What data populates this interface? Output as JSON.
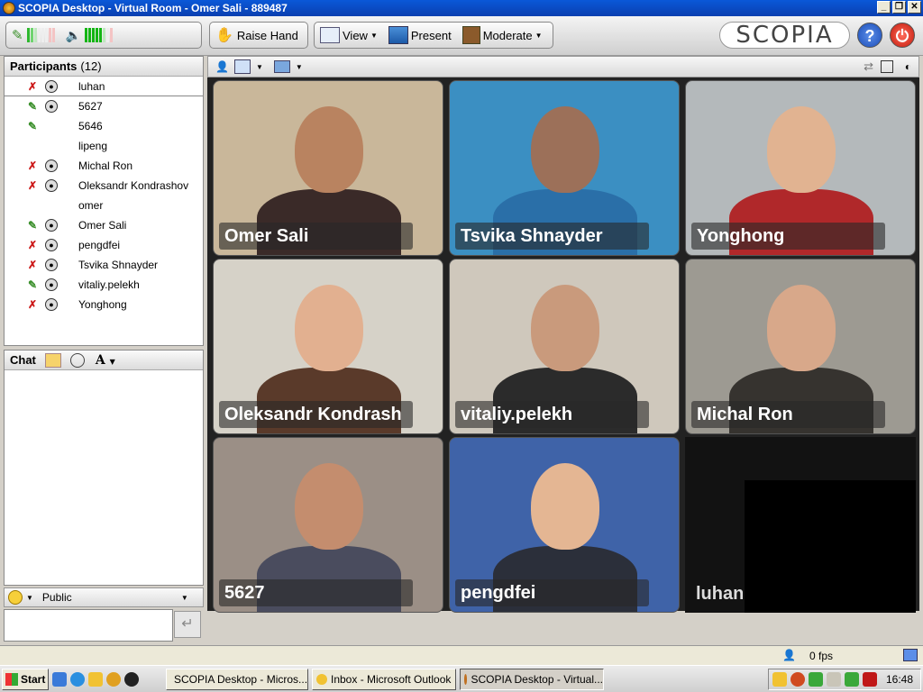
{
  "window": {
    "title": "SCOPIA Desktop - Virtual Room - Omer Sali - 889487"
  },
  "toolbar": {
    "raise_hand_label": "Raise Hand",
    "view_label": "View",
    "present_label": "Present",
    "moderate_label": "Moderate",
    "logo_text": "SCOPIA",
    "help_label": "?"
  },
  "participants": {
    "title": "Participants",
    "count": "(12)",
    "items": [
      {
        "name": "luhan",
        "mic": "muted",
        "camera": true
      },
      {
        "name": "5627",
        "mic": "on",
        "camera": true
      },
      {
        "name": "5646",
        "mic": "on",
        "camera": false
      },
      {
        "name": "lipeng",
        "mic": "none",
        "camera": false
      },
      {
        "name": "Michal Ron",
        "mic": "muted",
        "camera": true
      },
      {
        "name": "Oleksandr Kondrashov",
        "mic": "muted",
        "camera": true
      },
      {
        "name": "omer",
        "mic": "none",
        "camera": false
      },
      {
        "name": "Omer Sali",
        "mic": "on",
        "camera": true
      },
      {
        "name": "pengdfei",
        "mic": "muted",
        "camera": true
      },
      {
        "name": "Tsvika Shnayder",
        "mic": "muted",
        "camera": true
      },
      {
        "name": "vitaliy.pelekh",
        "mic": "on",
        "camera": true
      },
      {
        "name": "Yonghong",
        "mic": "muted",
        "camera": true
      }
    ]
  },
  "chat": {
    "title": "Chat",
    "channel": "Public",
    "font_label": "A"
  },
  "video": {
    "tiles": [
      {
        "name": "Omer Sali",
        "bg": "#c9b79a",
        "skin": "#b98360",
        "shirt": "#3a2a28"
      },
      {
        "name": "Tsvika Shnayder",
        "bg": "#3b8fc2",
        "skin": "#9c7059",
        "shirt": "#2a6fa8"
      },
      {
        "name": "Yonghong",
        "bg": "#b4b9bb",
        "skin": "#e1b391",
        "shirt": "#b0282a"
      },
      {
        "name": "Oleksandr Kondrash",
        "bg": "#d6d2c8",
        "skin": "#e2b090",
        "shirt": "#5a3a2a"
      },
      {
        "name": "vitaliy.pelekh",
        "bg": "#cfc8bc",
        "skin": "#c99a7c",
        "shirt": "#2b2b2b"
      },
      {
        "name": "Michal Ron",
        "bg": "#9d9a92",
        "skin": "#d8a88a",
        "shirt": "#36332f"
      },
      {
        "name": "5627",
        "bg": "#9b8f86",
        "skin": "#c48d6e",
        "shirt": "#4a4c5e"
      },
      {
        "name": "pengdfei",
        "bg": "#3f63a8",
        "skin": "#e4b693",
        "shirt": "#2b2f3a"
      },
      {
        "name": "luhan",
        "bg": "#121212",
        "skin": "#121212",
        "shirt": "#121212"
      }
    ]
  },
  "status": {
    "fps": "0 fps"
  },
  "taskbar": {
    "start_label": "Start",
    "tasks": [
      "SCOPIA Desktop - Micros...",
      "Inbox - Microsoft Outlook",
      "SCOPIA Desktop - Virtual..."
    ],
    "clock": "16:48"
  },
  "colors": {
    "accent": "#0a58d8",
    "mic_on": "#3a8f2a",
    "mic_muted": "#cc1a1a"
  }
}
